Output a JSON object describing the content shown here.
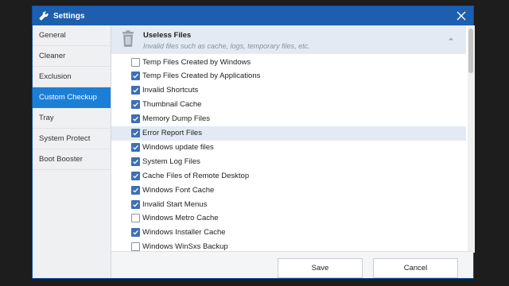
{
  "window": {
    "title": "Settings"
  },
  "sidebar": {
    "items": [
      {
        "label": "General",
        "active": false
      },
      {
        "label": "Cleaner",
        "active": false
      },
      {
        "label": "Exclusion",
        "active": false
      },
      {
        "label": "Custom Checkup",
        "active": true
      },
      {
        "label": "Tray",
        "active": false
      },
      {
        "label": "System Protect",
        "active": false
      },
      {
        "label": "Boot Booster",
        "active": false
      }
    ]
  },
  "group": {
    "title": "Useless Files",
    "description": "Invalid files such as cache, logs, temporary files, etc.",
    "expanded": true
  },
  "options": [
    {
      "label": "Temp Files Created by Windows",
      "checked": false
    },
    {
      "label": "Temp Files Created by Applications",
      "checked": true
    },
    {
      "label": "Invalid Shortcuts",
      "checked": true
    },
    {
      "label": "Thumbnail Cache",
      "checked": true
    },
    {
      "label": "Memory Dump Files",
      "checked": true
    },
    {
      "label": "Error Report Files",
      "checked": true,
      "highlight": true
    },
    {
      "label": "Windows update files",
      "checked": true
    },
    {
      "label": "System Log Files",
      "checked": true
    },
    {
      "label": "Cache Files of Remote Desktop",
      "checked": true
    },
    {
      "label": "Windows Font Cache",
      "checked": true
    },
    {
      "label": "Invalid Start Menus",
      "checked": true
    },
    {
      "label": "Windows Metro Cache",
      "checked": false
    },
    {
      "label": "Windows Installer Cache",
      "checked": true
    },
    {
      "label": "Windows WinSxs Backup",
      "checked": false
    }
  ],
  "footer": {
    "save_label": "Save",
    "cancel_label": "Cancel"
  },
  "colors": {
    "titlebar": "#1d5fae",
    "active_nav": "#1c7fd6",
    "checkbox": "#3e6fb3",
    "highlight_row": "#e4eaf3"
  }
}
